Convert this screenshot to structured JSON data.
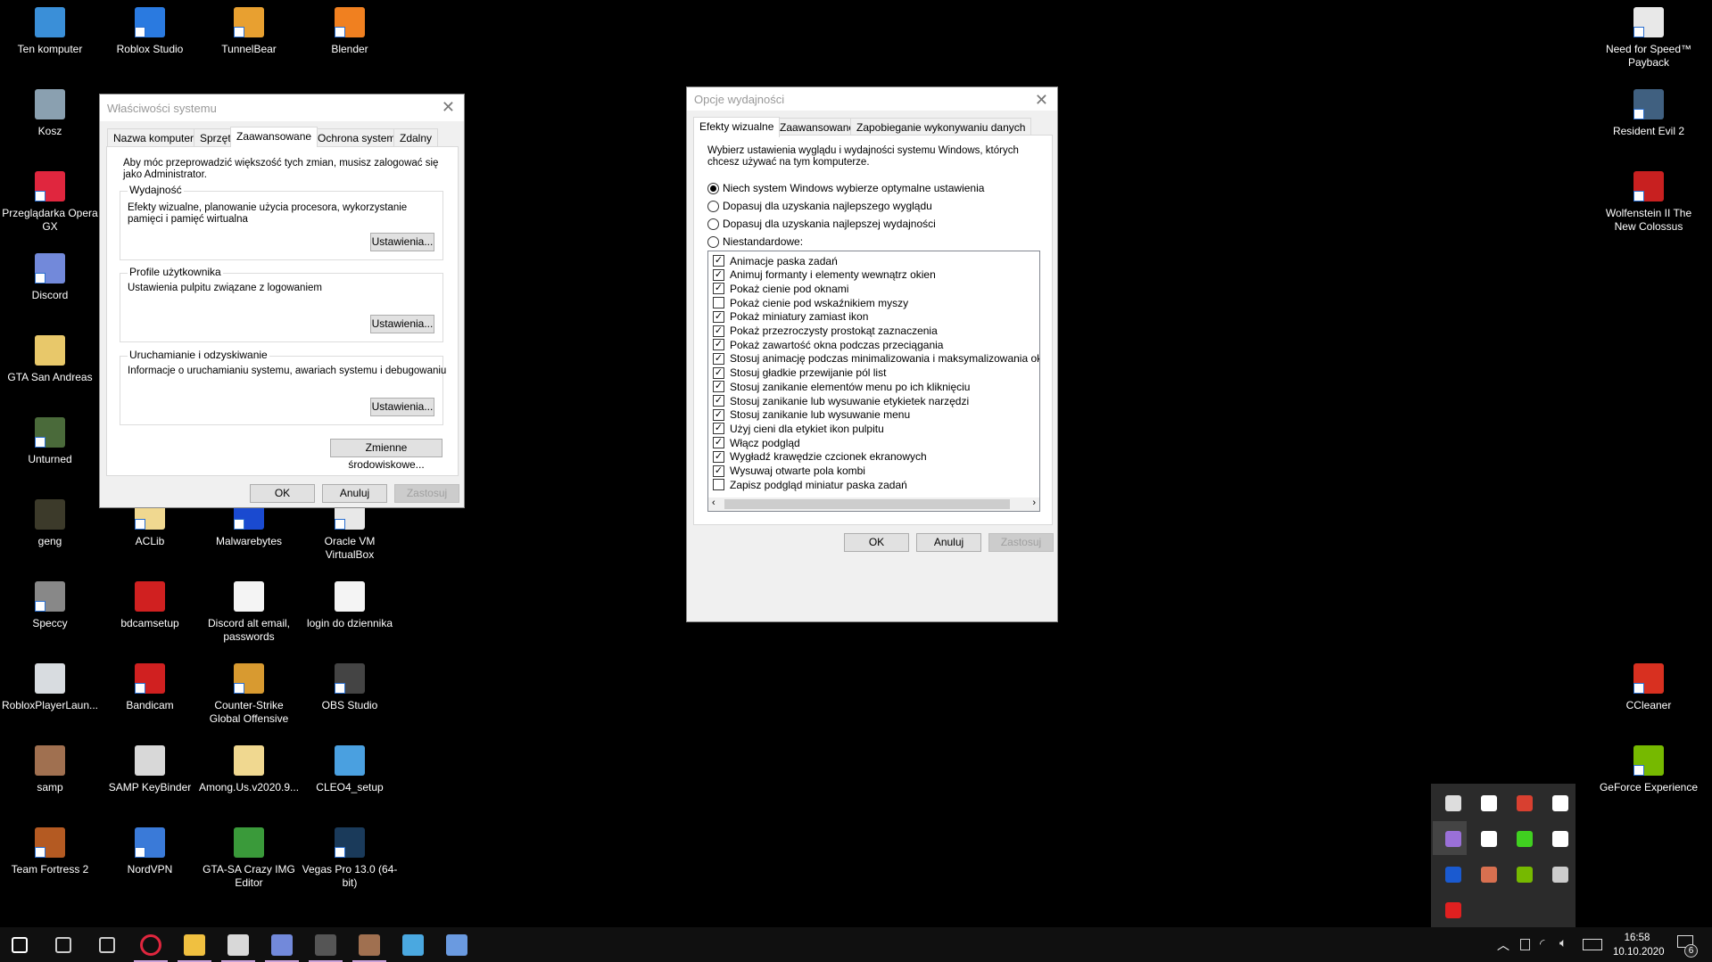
{
  "desktop": {
    "icons": [
      {
        "label": "Ten komputer",
        "color": "#3a8fd8",
        "shortcut": false
      },
      {
        "label": "Kosz",
        "color": "#8aa0b0",
        "shortcut": false
      },
      {
        "label": "Przeglądarka Opera GX",
        "color": "#e0263e",
        "shortcut": true
      },
      {
        "label": "Discord",
        "color": "#7289da",
        "shortcut": true
      },
      {
        "label": "GTA San Andreas",
        "color": "#e8c86a",
        "shortcut": false
      },
      {
        "label": "Unturned",
        "color": "#4a6a3a",
        "shortcut": true
      },
      {
        "label": "geng",
        "color": "#3c3a2a",
        "shortcut": false
      },
      {
        "label": "Speccy",
        "color": "#888",
        "shortcut": true
      },
      {
        "label": "RobloxPlayerLaun...",
        "color": "#d8dce0",
        "shortcut": false
      },
      {
        "label": "samp",
        "color": "#a07050",
        "shortcut": false
      },
      {
        "label": "Team Fortress 2",
        "color": "#b45a22",
        "shortcut": true
      },
      {
        "label": "Roblox Studio",
        "color": "#2a7ae0",
        "shortcut": true
      },
      {
        "label": "ACLib",
        "color": "#f0d890",
        "shortcut": true
      },
      {
        "label": "bdcamsetup",
        "color": "#d02020",
        "shortcut": false
      },
      {
        "label": "Bandicam",
        "color": "#d02020",
        "shortcut": true
      },
      {
        "label": "SAMP KeyBinder",
        "color": "#d8d8d8",
        "shortcut": false
      },
      {
        "label": "NordVPN",
        "color": "#3a7ad8",
        "shortcut": true
      },
      {
        "label": "TunnelBear",
        "color": "#e8a030",
        "shortcut": true
      },
      {
        "label": "Malwarebytes",
        "color": "#1a4ad0",
        "shortcut": true
      },
      {
        "label": "Discord alt email, passwords",
        "color": "#f4f4f4",
        "shortcut": false
      },
      {
        "label": "Counter-Strike Global Offensive",
        "color": "#d89a30",
        "shortcut": true
      },
      {
        "label": "Among.Us.v2020.9...",
        "color": "#f0d890",
        "shortcut": false
      },
      {
        "label": "GTA-SA Crazy IMG Editor",
        "color": "#3a9a3a",
        "shortcut": false
      },
      {
        "label": "Blender",
        "color": "#f08020",
        "shortcut": true
      },
      {
        "label": "Oracle VM VirtualBox",
        "color": "#e8e8e8",
        "shortcut": true
      },
      {
        "label": "login do dziennika",
        "color": "#f4f4f4",
        "shortcut": false
      },
      {
        "label": "OBS Studio",
        "color": "#444",
        "shortcut": true
      },
      {
        "label": "CLEO4_setup",
        "color": "#4aa0e0",
        "shortcut": false
      },
      {
        "label": "Vegas Pro 13.0 (64-bit)",
        "color": "#1a3a5a",
        "shortcut": true
      },
      {
        "label": "Need for Speed™ Payback",
        "color": "#e8e8e8",
        "shortcut": true
      },
      {
        "label": "Resident Evil 2",
        "color": "#406080",
        "shortcut": true
      },
      {
        "label": "Wolfenstein II The New Colossus",
        "color": "#c82020",
        "shortcut": true
      },
      {
        "label": "CCleaner",
        "color": "#d83020",
        "shortcut": true
      },
      {
        "label": "GeForce Experience",
        "color": "#76b900",
        "shortcut": true
      }
    ]
  },
  "system_properties": {
    "title": "Właściwości systemu",
    "tabs": [
      "Nazwa komputera",
      "Sprzęt",
      "Zaawansowane",
      "Ochrona systemu",
      "Zdalny"
    ],
    "active_tab": "Zaawansowane",
    "admin_note": "Aby móc przeprowadzić większość tych zmian, musisz zalogować się jako Administrator.",
    "groups": [
      {
        "legend": "Wydajność",
        "text": "Efekty wizualne, planowanie użycia procesora, wykorzystanie pamięci i pamięć wirtualna",
        "button": "Ustawienia..."
      },
      {
        "legend": "Profile użytkownika",
        "text": "Ustawienia pulpitu związane z logowaniem",
        "button": "Ustawienia..."
      },
      {
        "legend": "Uruchamianie i odzyskiwanie",
        "text": "Informacje o uruchamianiu systemu, awariach systemu i debugowaniu",
        "button": "Ustawienia..."
      }
    ],
    "env_button": "Zmienne środowiskowe...",
    "ok": "OK",
    "cancel": "Anuluj",
    "apply": "Zastosuj"
  },
  "performance_options": {
    "title": "Opcje wydajności",
    "tabs": [
      "Efekty wizualne",
      "Zaawansowane",
      "Zapobieganie wykonywaniu danych"
    ],
    "active_tab": "Efekty wizualne",
    "description": "Wybierz ustawienia wyglądu i wydajności systemu Windows, których chcesz używać na tym komputerze.",
    "radios": [
      {
        "label": "Niech system Windows wybierze optymalne ustawienia",
        "selected": true
      },
      {
        "label": "Dopasuj dla uzyskania najlepszego wyglądu",
        "selected": false
      },
      {
        "label": "Dopasuj dla uzyskania najlepszej wydajności",
        "selected": false
      },
      {
        "label": "Niestandardowe:",
        "selected": false
      }
    ],
    "effects": [
      {
        "label": "Animacje paska zadań",
        "checked": true
      },
      {
        "label": "Animuj formanty i elementy wewnątrz okien",
        "checked": true
      },
      {
        "label": "Pokaż cienie pod oknami",
        "checked": true
      },
      {
        "label": "Pokaż cienie pod wskaźnikiem myszy",
        "checked": false
      },
      {
        "label": "Pokaż miniatury zamiast ikon",
        "checked": true
      },
      {
        "label": "Pokaż przezroczysty prostokąt zaznaczenia",
        "checked": true
      },
      {
        "label": "Pokaż zawartość okna podczas przeciągania",
        "checked": true
      },
      {
        "label": "Stosuj animację podczas minimalizowania i maksymalizowania okien",
        "checked": true
      },
      {
        "label": "Stosuj gładkie przewijanie pól list",
        "checked": true
      },
      {
        "label": "Stosuj zanikanie elementów menu po ich kliknięciu",
        "checked": true
      },
      {
        "label": "Stosuj zanikanie lub wysuwanie etykietek narzędzi",
        "checked": true
      },
      {
        "label": "Stosuj zanikanie lub wysuwanie menu",
        "checked": true
      },
      {
        "label": "Użyj cieni dla etykiet ikon pulpitu",
        "checked": true
      },
      {
        "label": "Włącz podgląd",
        "checked": true
      },
      {
        "label": "Wygładź krawędzie czcionek ekranowych",
        "checked": true
      },
      {
        "label": "Wysuwaj otwarte pola kombi",
        "checked": true
      },
      {
        "label": "Zapisz podgląd miniatur paska zadań",
        "checked": false
      }
    ],
    "ok": "OK",
    "cancel": "Anuluj",
    "apply": "Zastosuj"
  },
  "tray_overflow": {
    "icons": [
      {
        "name": "usb-safely-remove-icon",
        "color": "#ddd"
      },
      {
        "name": "windows-security-icon",
        "color": "#fff"
      },
      {
        "name": "ccleaner-icon",
        "color": "#d84030"
      },
      {
        "name": "discord-icon",
        "color": "#fff"
      },
      {
        "name": "feather-app-icon",
        "color": "#9a70d8"
      },
      {
        "name": "microphone-icon",
        "color": "#fff"
      },
      {
        "name": "green-status-icon",
        "color": "#40d020"
      },
      {
        "name": "storage-icon",
        "color": "#fff"
      },
      {
        "name": "malwarebytes-icon",
        "color": "#1a5ad0"
      },
      {
        "name": "speaker-icon",
        "color": "#d87050"
      },
      {
        "name": "nvidia-icon",
        "color": "#76b900"
      },
      {
        "name": "obs-icon",
        "color": "#ccc"
      },
      {
        "name": "roblox-icon",
        "color": "#e02020"
      }
    ]
  },
  "taskbar": {
    "apps": [
      {
        "name": "start-button",
        "color": "#fff",
        "running": false
      },
      {
        "name": "search-button",
        "color": "#ccc",
        "running": false
      },
      {
        "name": "task-view-button",
        "color": "#ccc",
        "running": false
      },
      {
        "name": "opera-gx-taskbar",
        "color": "#e0263e",
        "running": true
      },
      {
        "name": "file-explorer-taskbar",
        "color": "#f0c040",
        "running": true
      },
      {
        "name": "samp-keybinder-taskbar",
        "color": "#d8d8d8",
        "running": true
      },
      {
        "name": "discord-taskbar",
        "color": "#7289da",
        "running": true
      },
      {
        "name": "obs-taskbar",
        "color": "#555",
        "running": true
      },
      {
        "name": "samp-taskbar",
        "color": "#a07050",
        "running": true
      },
      {
        "name": "control-panel-taskbar",
        "color": "#4aa8e0",
        "running": false
      },
      {
        "name": "system-properties-taskbar",
        "color": "#6a9ae0",
        "running": false
      }
    ],
    "time": "16:58",
    "date": "10.10.2020",
    "notifications": "6"
  }
}
